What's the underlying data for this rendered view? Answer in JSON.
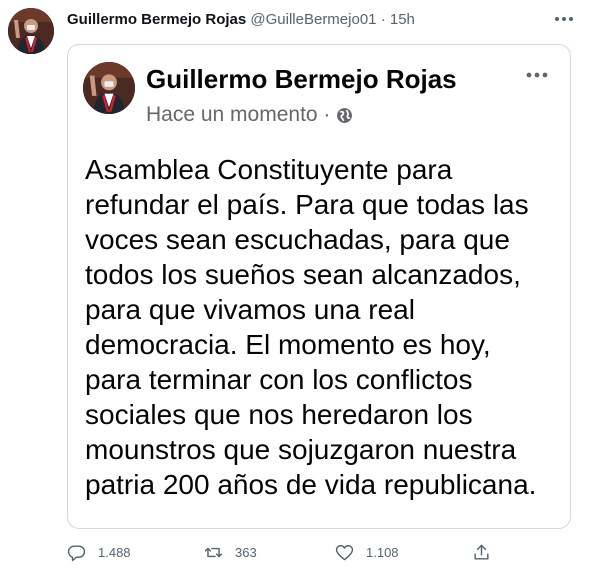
{
  "tweet": {
    "author_name": "Guillermo Bermejo Rojas",
    "handle": "@GuilleBermejo01",
    "separator": "·",
    "time": "15h",
    "more_icon": "more-dots-icon"
  },
  "card": {
    "author_name": "Guillermo Bermejo Rojas",
    "meta_text": "Hace un momento ·",
    "visibility_icon": "globe-icon",
    "more_icon": "more-dots-icon",
    "post_text": "Asamblea Constituyente para\nrefundar el país. Para que todas las\nvoces sean escuchadas, para que\ntodos los sueños sean alcanzados,\npara que vivamos una real\ndemocracia. El momento es hoy,\npara terminar con los conflictos\nsociales que nos heredaron los\nmounstros que sojuzgaron nuestra\npatria 200 años de vida republicana."
  },
  "actions": {
    "reply_count": "1.488",
    "retweet_count": "363",
    "like_count": "1.108",
    "icons": [
      "reply-icon",
      "retweet-icon",
      "like-icon",
      "share-icon"
    ]
  },
  "colors": {
    "secondary_text": "#536471",
    "card_border": "#cfd9de",
    "facebook_meta": "#65676b"
  }
}
